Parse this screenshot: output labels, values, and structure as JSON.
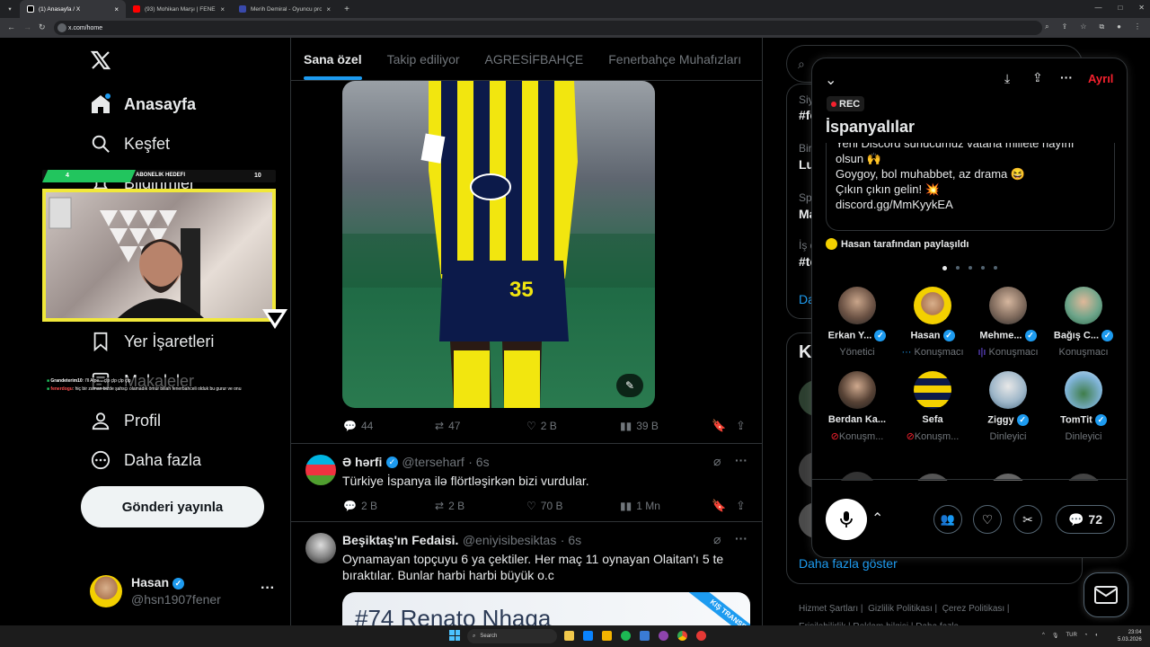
{
  "browser": {
    "tabs": [
      {
        "title": "(1) Anasayfa / X",
        "color": "#ffffff"
      },
      {
        "title": "(93) Mohikan Marşı | FENERBA",
        "color": "#ff0000"
      },
      {
        "title": "Merih Demiral - Oyuncu profili",
        "color": "#3949ab"
      }
    ],
    "new_tab": "+",
    "url": "x.com/home"
  },
  "nav": {
    "items": [
      {
        "label": "Anasayfa",
        "icon": "home-icon"
      },
      {
        "label": "Keşfet",
        "icon": "search-icon"
      },
      {
        "label": "Bildirimler",
        "icon": "bell-icon"
      },
      {
        "label": "Yer İşaretleri",
        "icon": "bookmark-icon"
      },
      {
        "label": "Makaleler",
        "icon": "article-icon"
      },
      {
        "label": "Profil",
        "icon": "profile-icon"
      },
      {
        "label": "Daha fazla",
        "icon": "more-circle-icon"
      }
    ],
    "post_button": "Gönderi yayınla",
    "account": {
      "name": "Hasan",
      "handle": "@hsn1907fener"
    }
  },
  "overlay": {
    "goal_label": "ABONELIK HEDEFI",
    "goal_current": "4",
    "goal_target": "10",
    "chat": [
      {
        "user": "Grandeterim10",
        "text": "I'll Alpe... çlp çlp çlp çlp"
      },
      {
        "user": "fenerdogu",
        "text": "hiç bir zaman bizde şahsçı olamadık ömür billah fenerbahceli olduk bu gurur ve onu"
      }
    ]
  },
  "feed": {
    "tabs": [
      "Sana özel",
      "Takip ediliyor",
      "AGRESİFBAHÇE",
      "Fenerbahçe Muhafızları",
      "FE"
    ],
    "first_post_stats": {
      "replies": "44",
      "reposts": "47",
      "likes": "2 B",
      "views": "39 B"
    },
    "tweets": [
      {
        "name": "Ə hərfi",
        "handle": "@terseharf",
        "time": "· 6s",
        "text": "Türkiye İspanya ilə flörtləşirkən bizi vurdular.",
        "replies": "2 B",
        "reposts": "2 B",
        "likes": "70 B",
        "views": "1 Mn"
      },
      {
        "name": "Beşiktaş'ın Fedaisi.",
        "handle": "@eniyisibesiktas",
        "time": "· 6s",
        "text": "Oynamayan topçuyu 6 ya çektiler. Her maç 11 oynayan Olaitan'ı 5 te bıraktılar. Bunlar harbi harbi büyük o.c",
        "card_title": "#74 Renato Nhaga",
        "card_ribbon": "KIŞ TRANSF"
      }
    ]
  },
  "space": {
    "rec": "REC",
    "title": "İspanyalılar",
    "leave": "Ayrıl",
    "message_lines": [
      "Yeni Discord sunucumuz vatana millete hayırlı",
      "olsun 🙌",
      "Goygoy, bol muhabbet, az drama 😆",
      "Çıkın çıkın gelin! 💥",
      " discord.gg/MmKyykEA"
    ],
    "shared_by": "Hasan tarafından paylaşıldı",
    "speakers": [
      {
        "name": "Erkan Y...",
        "role": "Yönetici",
        "verified": true,
        "mic": "none"
      },
      {
        "name": "Hasan",
        "role": "Konuşmacı",
        "verified": true,
        "mic": "talking"
      },
      {
        "name": "Mehme...",
        "role": "Konuşmacı",
        "verified": true,
        "mic": "bars"
      },
      {
        "name": "Bağış C...",
        "role": "Konuşmacı",
        "verified": true,
        "mic": "none"
      },
      {
        "name": "Berdan Ka...",
        "role": "Konuşm...",
        "verified": false,
        "mic": "muted"
      },
      {
        "name": "Sefa",
        "role": "Konuşm...",
        "verified": false,
        "mic": "muted"
      },
      {
        "name": "Ziggy",
        "role": "Dinleyici",
        "verified": true,
        "mic": "none"
      },
      {
        "name": "TomTit",
        "role": "Dinleyici",
        "verified": true,
        "mic": "none"
      }
    ],
    "reply_count": "72"
  },
  "sidebar": {
    "search_placeholder": "A",
    "trend_prefixes": [
      "Siy",
      "#fe",
      "Birl",
      "Lu",
      "Spo",
      "Ma",
      "İş d",
      "#te"
    ],
    "show_more_short": "Da",
    "who_heading": "Ki",
    "show_more": "Daha fazla göster",
    "footer": [
      "Hizmet Şartları",
      "Gizlilik Politikası",
      "Çerez Politikası",
      "Erişilebilirlik",
      "Reklam bilgisi",
      "Daha fazla"
    ]
  },
  "taskbar": {
    "search": "Search",
    "lang": "TUR",
    "time": "23:04",
    "date": "5.03.2026"
  }
}
